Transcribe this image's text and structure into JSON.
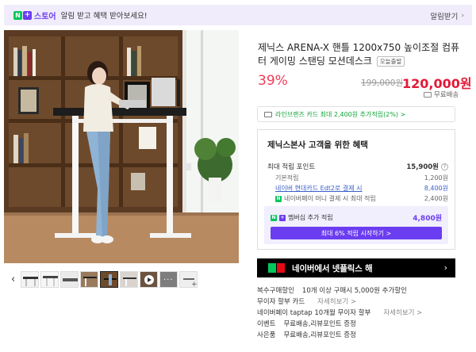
{
  "topbar": {
    "badge_n": "N",
    "badge_plus": "+",
    "store_label": "스토어",
    "message": "알림 받고 혜택 받아보세요!",
    "subscribe_label": "알림받기"
  },
  "gallery": {
    "thumbnails": [
      {
        "name": "desk-front"
      },
      {
        "name": "desk-side"
      },
      {
        "name": "desk-top"
      },
      {
        "name": "desk-room"
      },
      {
        "name": "desk-woman"
      },
      {
        "name": "desk-white"
      },
      {
        "name": "desk-video"
      },
      {
        "name": "desk-more"
      },
      {
        "name": "desk-extra"
      }
    ],
    "active_index": 4
  },
  "product": {
    "title": "제닉스 ARENA-X 핸틀 1200x750 높이조절 컴퓨터 게이밍 스탠딩 모션데스크",
    "tag": "오늘출발",
    "discount": "39%",
    "original_price": "199,000원",
    "sale_price": "120,000원",
    "shipping": "무료배송"
  },
  "card_promo": {
    "text": "라인브랜즈 카드 최대 2,400원 추가적립(2%) >"
  },
  "benefits": {
    "title": "제닉스본사 고객을 위한 혜택",
    "max_points_label": "최대 적립 포인트",
    "max_points_value": "15,900원",
    "rows": [
      {
        "label": "기본적립",
        "value": "1,200원"
      },
      {
        "label": "네이버 현대카드 Edt2로 결제 시",
        "value": "8,400원"
      },
      {
        "label": "네이버페이 머니 결제 시 최대 적립",
        "value": "2,400원"
      }
    ],
    "member_label": "멤버십 추가 적립",
    "member_value": "4,800원",
    "member_button": "최대 6% 적립 시작하기 >"
  },
  "banner": {
    "text": "네이버에서 넷플릭스 해",
    "arrow": "›"
  },
  "info": {
    "rows": [
      {
        "key": "복수구매할인",
        "value": "10개 이상 구매시 5,000원 추가할인",
        "link": ""
      },
      {
        "key": "무이자 할부 카드",
        "value": "",
        "link": "자세히보기 >"
      },
      {
        "key": "네이버페이 taptap 10개월 무이자 할부",
        "value": "",
        "link": "자세히보기 >"
      },
      {
        "key": "이벤트",
        "value": "무료배송,리뷰포인트 증정",
        "link": ""
      },
      {
        "key": "사은품",
        "value": "무료배송,리뷰포인트 증정",
        "link": ""
      }
    ]
  },
  "colors": {
    "accent_purple": "#6b3df0",
    "naver_green": "#03c75a",
    "price_red": "#e31937"
  }
}
